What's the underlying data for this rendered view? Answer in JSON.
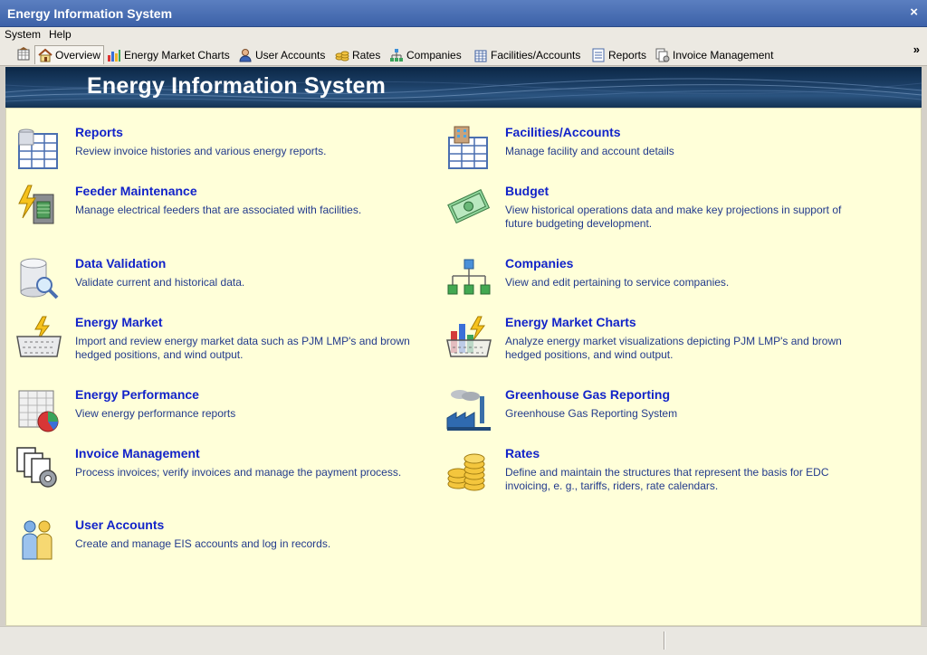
{
  "window": {
    "title": "Energy Information System",
    "close_glyph": "×"
  },
  "menu": {
    "items": [
      "System",
      "Help"
    ]
  },
  "toolbar": {
    "home_icon": "grid-home-icon",
    "tabs": [
      {
        "label": "Overview",
        "icon": "house-icon",
        "active": true
      },
      {
        "label": "Energy Market Charts",
        "icon": "bar-chart-icon"
      },
      {
        "label": "User Accounts",
        "icon": "user-icon"
      },
      {
        "label": "Rates",
        "icon": "coins-icon"
      },
      {
        "label": "Companies",
        "icon": "org-chart-icon"
      },
      {
        "label": "Facilities/Accounts",
        "icon": "building-icon"
      },
      {
        "label": "Reports",
        "icon": "report-icon"
      },
      {
        "label": "Invoice Management",
        "icon": "invoice-icon"
      }
    ],
    "more_glyph": "»"
  },
  "banner": {
    "title": "Energy Information System"
  },
  "items": [
    {
      "title": "Reports",
      "description": "Review invoice histories and various energy reports.",
      "icon": "report-grid-icon"
    },
    {
      "title": "Facilities/Accounts",
      "description": "Manage facility and account details",
      "icon": "building-grid-icon"
    },
    {
      "title": "Feeder Maintenance",
      "description": "Manage electrical feeders that are associated with facilities.",
      "icon": "lightning-icon"
    },
    {
      "title": "Budget",
      "description": "View historical operations data and make key projections in support of future budgeting development.",
      "icon": "money-icon"
    },
    {
      "title": "Data Validation",
      "description": "Validate current and historical data.",
      "icon": "database-search-icon"
    },
    {
      "title": "Companies",
      "description": "View and edit pertaining to service companies.",
      "icon": "org-chart-icon"
    },
    {
      "title": "Energy Market",
      "description": "Import and review energy market data such as PJM LMP's and brown hedged positions, and wind output.",
      "icon": "basket-icon"
    },
    {
      "title": "Energy Market Charts",
      "description": "Analyze energy market visualizations depicting PJM LMP's and brown hedged positions, and wind output.",
      "icon": "basket-chart-icon"
    },
    {
      "title": "Energy Performance",
      "description": "View energy performance reports",
      "icon": "spreadsheet-pie-icon"
    },
    {
      "title": "Greenhouse Gas Reporting",
      "description": "Greenhouse Gas Reporting System",
      "icon": "factory-icon"
    },
    {
      "title": "Invoice Management",
      "description": "Process invoices; verify invoices and manage the payment process.",
      "icon": "documents-gear-icon"
    },
    {
      "title": "Rates",
      "description": "Define and maintain the structures that represent the basis for EDC invoicing, e. g., tariffs, riders, rate calendars.",
      "icon": "coins-icon"
    },
    {
      "title": "User Accounts",
      "description": "Create and manage EIS accounts and log in records.",
      "icon": "users-icon"
    }
  ]
}
